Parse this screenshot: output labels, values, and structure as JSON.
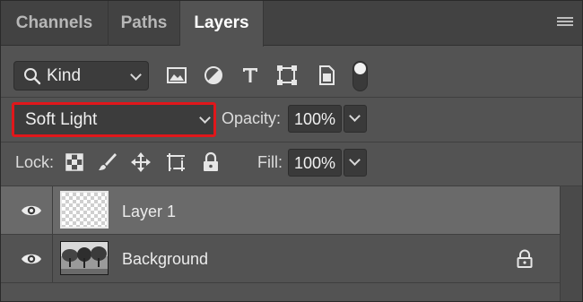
{
  "tabs": [
    {
      "label": "Channels",
      "active": false
    },
    {
      "label": "Paths",
      "active": false
    },
    {
      "label": "Layers",
      "active": true
    }
  ],
  "filter": {
    "kind_label": "Kind",
    "icons": [
      "image-filter-icon",
      "adjustment-filter-icon",
      "type-filter-icon",
      "shape-filter-icon",
      "smart-object-filter-icon"
    ]
  },
  "blend": {
    "mode": "Soft Light",
    "opacity_label": "Opacity:",
    "opacity_value": "100%"
  },
  "lock": {
    "label": "Lock:",
    "fill_label": "Fill:",
    "fill_value": "100%"
  },
  "layers": [
    {
      "name": "Layer 1",
      "selected": true,
      "locked": false
    },
    {
      "name": "Background",
      "selected": false,
      "locked": true
    }
  ],
  "colors": {
    "panel": "#535353",
    "highlight_border": "#e0171b",
    "selected_row": "#6a6a6a"
  }
}
